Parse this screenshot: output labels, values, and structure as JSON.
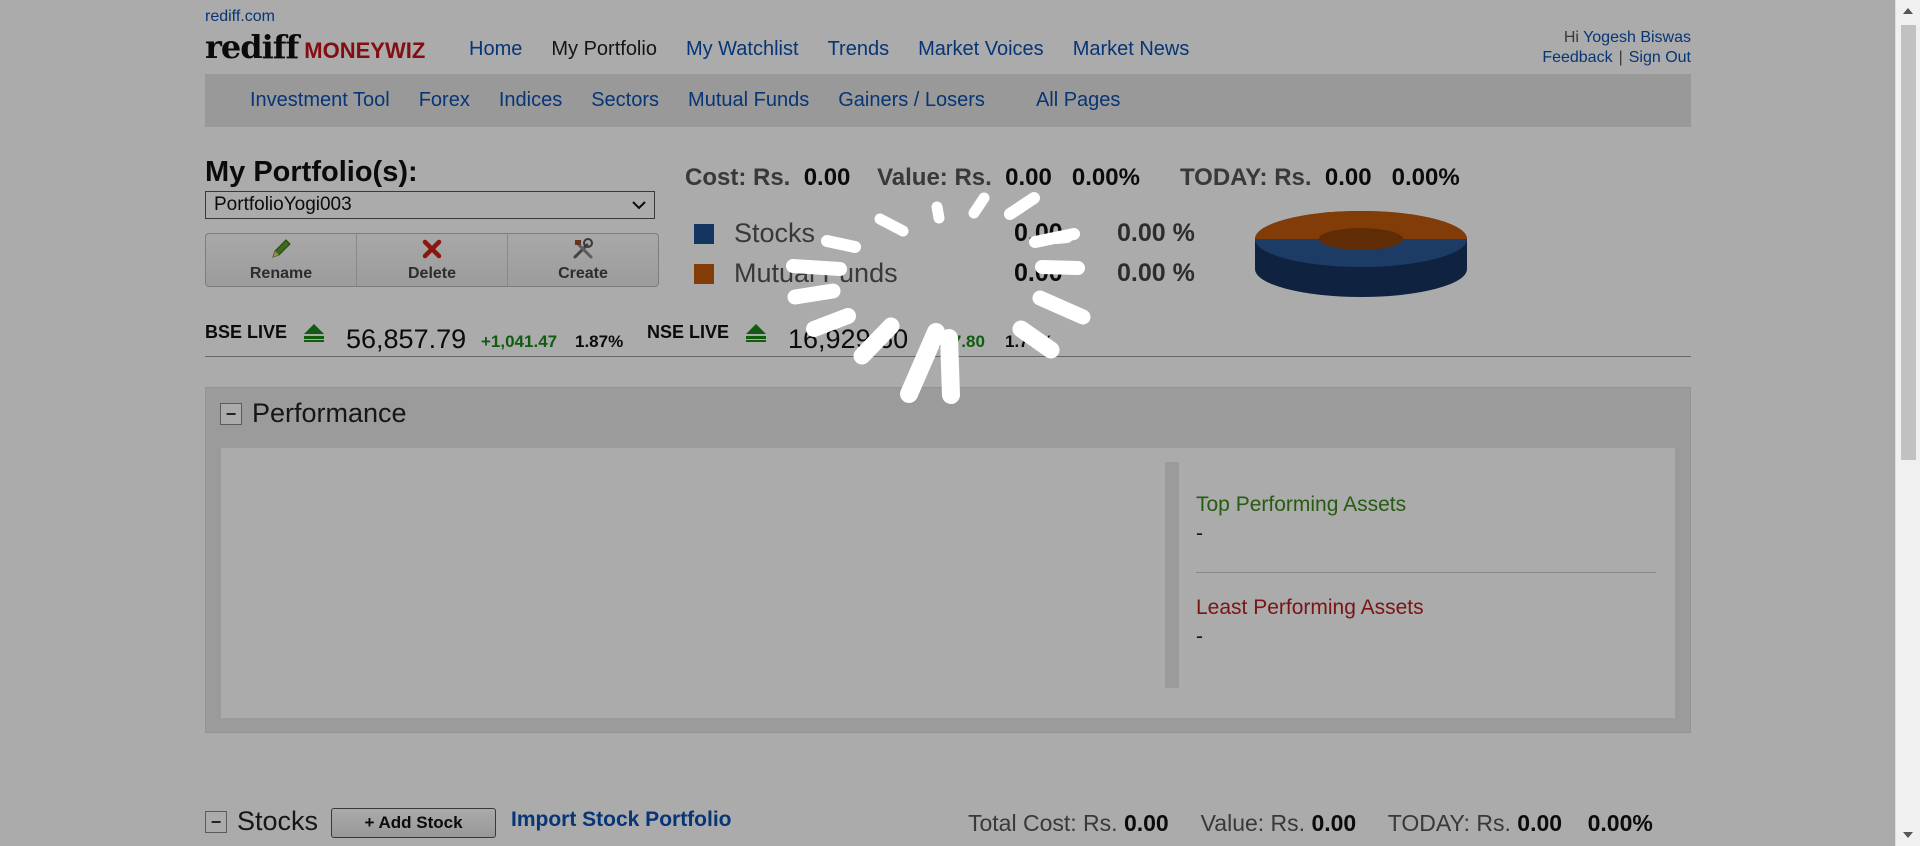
{
  "header": {
    "site_link": "rediff.com",
    "logo_main": "rediff",
    "logo_sub": "MONEYWIZ",
    "nav": [
      "Home",
      "My Portfolio",
      "My Watchlist",
      "Trends",
      "Market Voices",
      "Market News"
    ],
    "active_nav": "My Portfolio",
    "greeting": "Hi",
    "user_name": "Yogesh Biswas",
    "feedback": "Feedback",
    "separator": "|",
    "signout": "Sign Out"
  },
  "subnav": [
    "Investment Tool",
    "Forex",
    "Indices",
    "Sectors",
    "Mutual Funds",
    "Gainers / Losers",
    "All Pages"
  ],
  "portfolio": {
    "title": "My Portfolio(s):",
    "selected": "PortfolioYogi003",
    "buttons": {
      "rename": "Rename",
      "delete": "Delete",
      "create": "Create"
    }
  },
  "summary": {
    "cost_label": "Cost: Rs.",
    "cost": "0.00",
    "value_label": "Value: Rs.",
    "value": "0.00",
    "value_pct": "0.00%",
    "today_label": "TODAY: Rs.",
    "today": "0.00",
    "today_pct": "0.00%"
  },
  "allocation": [
    {
      "name": "Stocks",
      "value": "0.00",
      "pct": "0.00 %",
      "color": "#1f4f8f"
    },
    {
      "name": "Mutual Funds",
      "value": "0.00",
      "pct": "0.00 %",
      "color": "#c25a0c"
    }
  ],
  "indices": {
    "bse_label": "BSE LIVE",
    "bse_value": "56,857.79",
    "bse_change": "+1,041.47",
    "bse_pct": "1.87%",
    "nse_label": "NSE LIVE",
    "nse_value": "16,929.60",
    "nse_change": "+287.80",
    "nse_pct": "1.73%"
  },
  "performance": {
    "title": "Performance",
    "collapse_symbol": "−",
    "top_label": "Top Performing Assets",
    "top_value": "-",
    "least_label": "Least Performing Assets",
    "least_value": "-"
  },
  "stocks": {
    "title": "Stocks",
    "collapse_symbol": "−",
    "add_label": "+ Add Stock",
    "import_label": "Import Stock Portfolio",
    "total_cost_label": "Total Cost: Rs.",
    "total_cost": "0.00",
    "value_label": "Value: Rs.",
    "value": "0.00",
    "today_label": "TODAY: Rs.",
    "today": "0.00",
    "today_pct": "0.00%"
  },
  "colors": {
    "link": "#0b4fb0",
    "positive": "#1b8a1b",
    "top_assets": "#3a8a1a",
    "least_assets": "#b32222",
    "logo_red": "#c4161c"
  },
  "icons": [
    "pencil-icon",
    "delete-x-icon",
    "tools-icon",
    "up-arrow-icon",
    "loading-spinner-icon"
  ]
}
